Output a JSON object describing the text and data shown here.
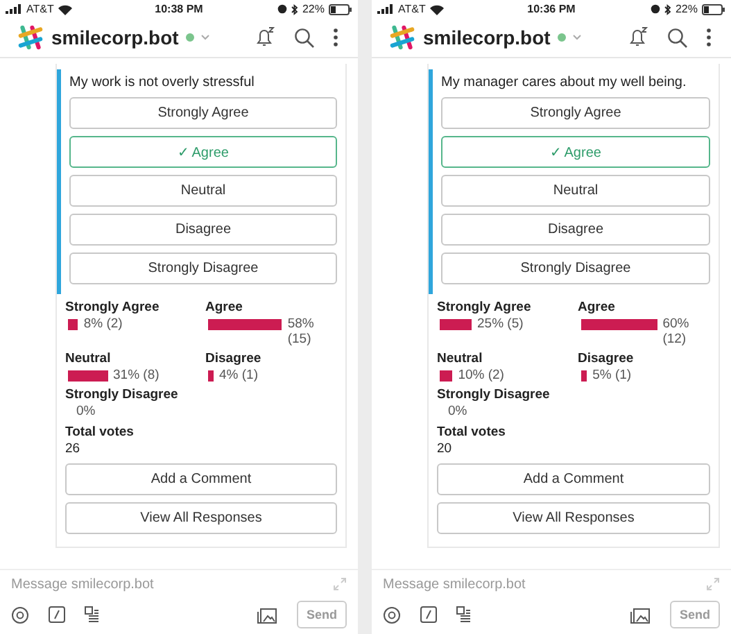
{
  "phones": [
    {
      "status_bar": {
        "carrier": "AT&T",
        "time": "10:38 PM",
        "battery": "22%"
      },
      "header": {
        "title": "smilecorp.bot",
        "online": true
      },
      "poll": {
        "question": "My work is not overly stressful",
        "selected_mark": "✓",
        "options": [
          {
            "label": "Strongly Agree",
            "selected": false
          },
          {
            "label": "Agree",
            "selected": true
          },
          {
            "label": "Neutral",
            "selected": false
          },
          {
            "label": "Disagree",
            "selected": false
          },
          {
            "label": "Strongly Disagree",
            "selected": false
          }
        ],
        "results": [
          {
            "label": "Strongly Agree",
            "reading": "8% (2)"
          },
          {
            "label": "Agree",
            "reading": "58% (15)"
          },
          {
            "label": "Neutral",
            "reading": "31% (8)"
          },
          {
            "label": "Disagree",
            "reading": "4% (1)"
          },
          {
            "label": "Strongly Disagree",
            "reading": "0%"
          }
        ],
        "total_label": "Total votes",
        "total": "26",
        "actions": [
          "Add a Comment",
          "View All Responses"
        ]
      },
      "composer": {
        "placeholder": "Message smilecorp.bot",
        "send": "Send"
      }
    },
    {
      "status_bar": {
        "carrier": "AT&T",
        "time": "10:36 PM",
        "battery": "22%"
      },
      "header": {
        "title": "smilecorp.bot",
        "online": true
      },
      "poll": {
        "question": "My manager cares about my well being.",
        "selected_mark": "✓",
        "options": [
          {
            "label": "Strongly Agree",
            "selected": false
          },
          {
            "label": "Agree",
            "selected": true
          },
          {
            "label": "Neutral",
            "selected": false
          },
          {
            "label": "Disagree",
            "selected": false
          },
          {
            "label": "Strongly Disagree",
            "selected": false
          }
        ],
        "results": [
          {
            "label": "Strongly Agree",
            "reading": "25% (5)"
          },
          {
            "label": "Agree",
            "reading": "60% (12)"
          },
          {
            "label": "Neutral",
            "reading": "10% (2)"
          },
          {
            "label": "Disagree",
            "reading": "5% (1)"
          },
          {
            "label": "Strongly Disagree",
            "reading": "0%"
          }
        ],
        "total_label": "Total votes",
        "total": "20",
        "actions": [
          "Add a Comment",
          "View All Responses"
        ]
      },
      "composer": {
        "placeholder": "Message smilecorp.bot",
        "send": "Send"
      }
    }
  ]
}
